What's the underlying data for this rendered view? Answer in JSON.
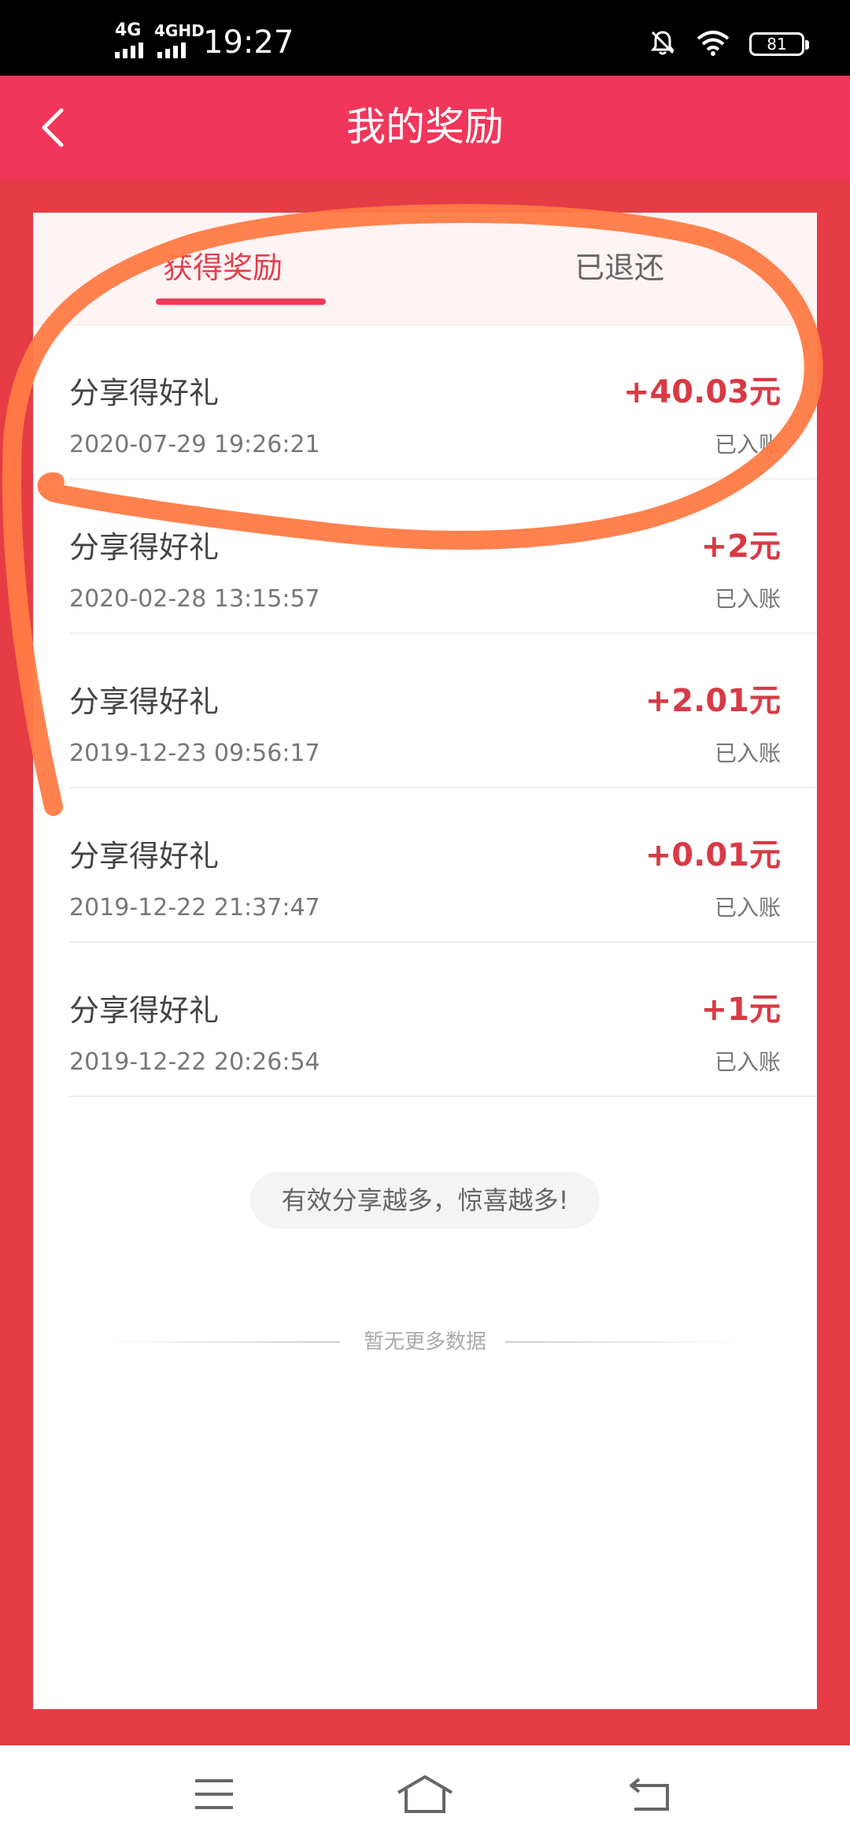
{
  "status_bar": {
    "network_1": "4G",
    "network_2": "4GHD",
    "time": "19:27",
    "battery": "81"
  },
  "header": {
    "title": "我的奖励"
  },
  "tabs": [
    {
      "label": "获得奖励",
      "active": true
    },
    {
      "label": "已退还",
      "active": false
    }
  ],
  "rewards": [
    {
      "title": "分享得好礼",
      "date": "2020-07-29 19:26:21",
      "amount": "+40.03元",
      "status": "已入账"
    },
    {
      "title": "分享得好礼",
      "date": "2020-02-28 13:15:57",
      "amount": "+2元",
      "status": "已入账"
    },
    {
      "title": "分享得好礼",
      "date": "2019-12-23 09:56:17",
      "amount": "+2.01元",
      "status": "已入账"
    },
    {
      "title": "分享得好礼",
      "date": "2019-12-22 21:37:47",
      "amount": "+0.01元",
      "status": "已入账"
    },
    {
      "title": "分享得好礼",
      "date": "2019-12-22 20:26:54",
      "amount": "+1元",
      "status": "已入账"
    }
  ],
  "tip": "有效分享越多，惊喜越多!",
  "no_more": "暂无更多数据",
  "colors": {
    "header": "#f0365a",
    "frame": "#e63c45",
    "amount": "#d83a44",
    "annotation": "#ff7a45"
  },
  "icons": {
    "back": "chevron-left-icon",
    "menu": "menu-icon",
    "home": "home-icon",
    "nav_back": "return-icon"
  }
}
